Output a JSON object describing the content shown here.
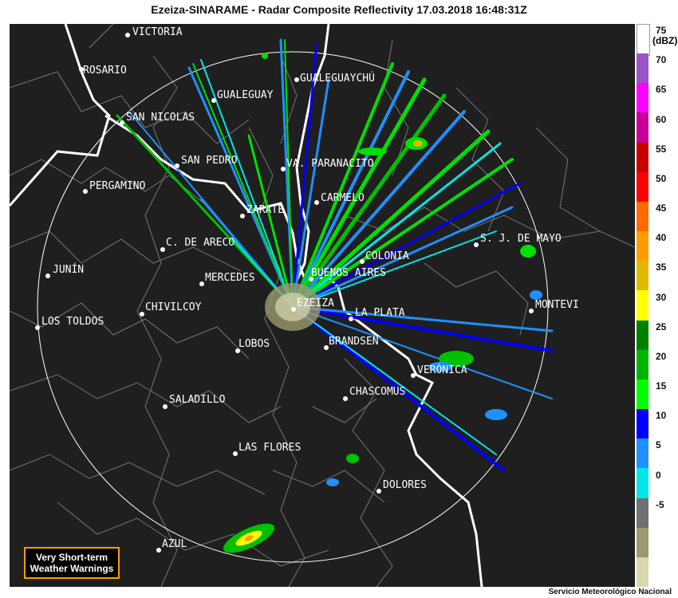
{
  "header": {
    "title": "Ezeiza-SINARAME - Radar Composite Reflectivity 17.03.2018  16:48:31Z"
  },
  "legend": {
    "unit": "(dBZ)",
    "ticks": [
      "75",
      "70",
      "65",
      "60",
      "55",
      "50",
      "45",
      "40",
      "35",
      "30",
      "25",
      "20",
      "15",
      "10",
      "5",
      "0",
      "-5"
    ],
    "colors": [
      "#ffffff",
      "#9955c8",
      "#ff00ff",
      "#c80096",
      "#c80000",
      "#ff0000",
      "#ff6a00",
      "#ff9d00",
      "#e0b800",
      "#ffff00",
      "#008000",
      "#00b400",
      "#00ff00",
      "#0000ff",
      "#1e90ff",
      "#00e6e6",
      "#707070",
      "#9a9a70",
      "#d8d8b0"
    ]
  },
  "cities": [
    {
      "name": "VICTORIA"
    },
    {
      "name": "ROSARIO"
    },
    {
      "name": "GUALEGUAYCHÚ"
    },
    {
      "name": "GUALEGUAY"
    },
    {
      "name": "SAN NICOLAS"
    },
    {
      "name": "SAN PEDRO"
    },
    {
      "name": "VA. PARANACITO"
    },
    {
      "name": "PERGAMINO"
    },
    {
      "name": "CARMELO"
    },
    {
      "name": "ZARATE"
    },
    {
      "name": "S. J. DE MAYO"
    },
    {
      "name": "C. DE ARECO"
    },
    {
      "name": "COLONIA"
    },
    {
      "name": "JUNÍN"
    },
    {
      "name": "MERCEDES"
    },
    {
      "name": "BUENOS AIRES"
    },
    {
      "name": "MONTEVI"
    },
    {
      "name": "EZEIZA"
    },
    {
      "name": "CHIVILCOY"
    },
    {
      "name": "LA PLATA"
    },
    {
      "name": "LOS TOLDOS"
    },
    {
      "name": "LOBOS"
    },
    {
      "name": "BRANDSEN"
    },
    {
      "name": "VERÓNICA"
    },
    {
      "name": "CHASCOMUS"
    },
    {
      "name": "SALADILLO"
    },
    {
      "name": "LAS FLORES"
    },
    {
      "name": "DOLORES"
    },
    {
      "name": "AZUL"
    }
  ],
  "warning_button": {
    "line1": "Very Short-term",
    "line2": "Weather Warnings"
  },
  "footer": {
    "credit": "Servicio Meteorológico Nacional"
  }
}
